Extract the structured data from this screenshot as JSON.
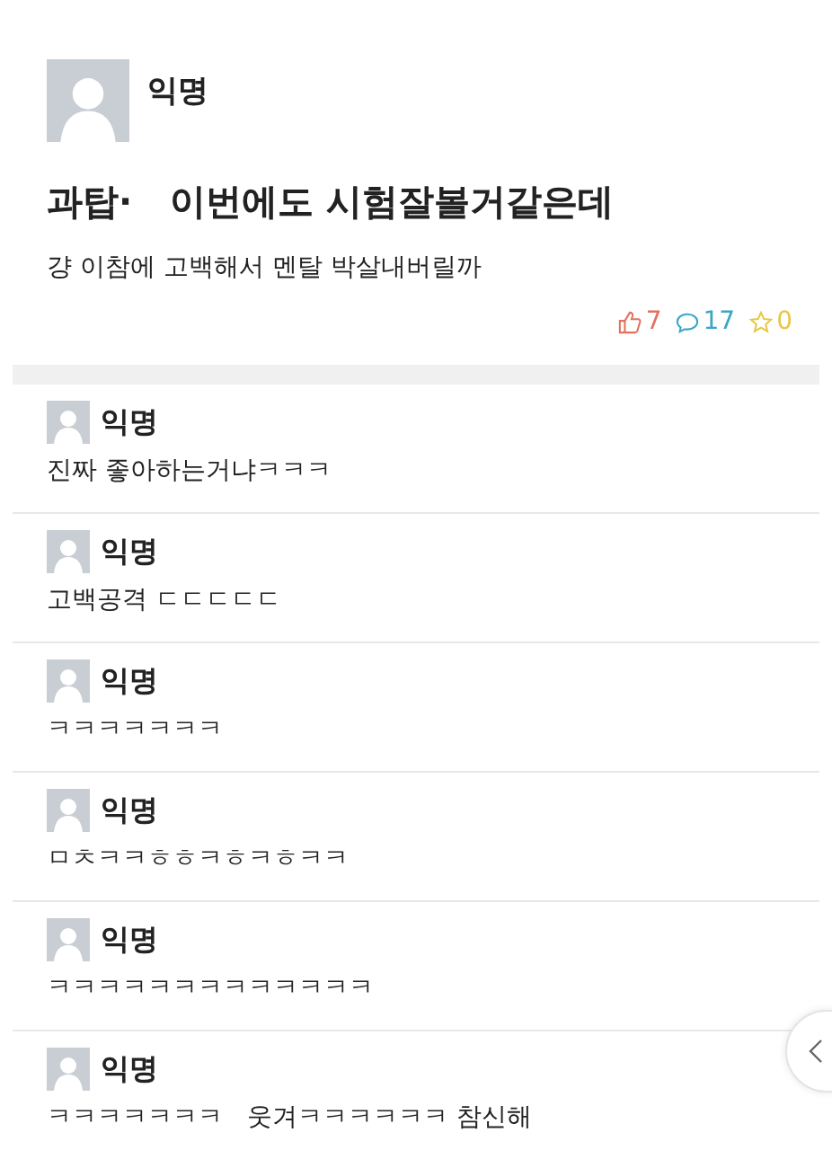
{
  "post": {
    "author": "익명",
    "title": "과탑·   이번에도 시험잘볼거같은데",
    "body": "걍 이참에 고백해서 멘탈 박살내버릴까",
    "stats": [
      {
        "kind": "like",
        "count": "7",
        "color": "#e2715e"
      },
      {
        "kind": "comment",
        "count": "17",
        "color": "#3aa6c4"
      },
      {
        "kind": "scrap",
        "count": "0",
        "color": "#e8c744"
      }
    ]
  },
  "comments": [
    {
      "author": "익명",
      "text": "진짜 좋아하는거냐ㅋㅋㅋ"
    },
    {
      "author": "익명",
      "text": "고백공격 ㄷㄷㄷㄷㄷ"
    },
    {
      "author": "익명",
      "text": "ㅋㅋㅋㅋㅋㅋㅋ"
    },
    {
      "author": "익명",
      "text": "ㅁㅊㅋㅋㅎㅎㅋㅎㅋㅎㅋㅋ"
    },
    {
      "author": "익명",
      "text": "ㅋㅋㅋㅋㅋㅋㅋㅋㅋㅋㅋㅋㅋ"
    },
    {
      "author": "익명",
      "text": "ㅋㅋㅋㅋㅋㅋㅋ   웃겨ㅋㅋㅋㅋㅋㅋ 참신해"
    }
  ]
}
